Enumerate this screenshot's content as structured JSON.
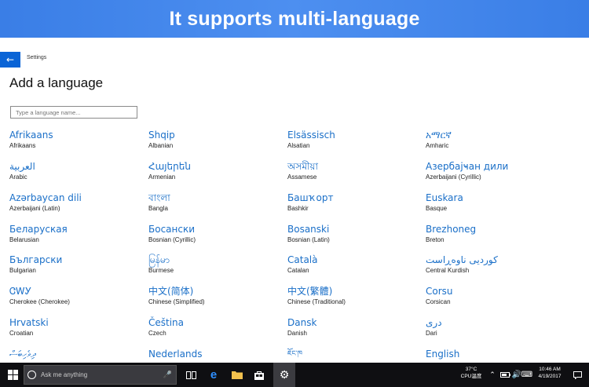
{
  "banner": {
    "title": "It supports multi-language"
  },
  "header": {
    "breadcrumb": "Settings",
    "title": "Add a language"
  },
  "search": {
    "placeholder": "Type a language name..."
  },
  "languages": [
    {
      "native": "Afrikaans",
      "english": "Afrikaans"
    },
    {
      "native": "Shqip",
      "english": "Albanian"
    },
    {
      "native": "Elsässisch",
      "english": "Alsatian"
    },
    {
      "native": "አማርኛ",
      "english": "Amharic"
    },
    {
      "native": "العربية",
      "english": "Arabic"
    },
    {
      "native": "Հայերեն",
      "english": "Armenian"
    },
    {
      "native": "অসমীয়া",
      "english": "Assamese"
    },
    {
      "native": "Азербајҹан дили",
      "english": "Azerbaijani (Cyrillic)"
    },
    {
      "native": "Azərbaycan dili",
      "english": "Azerbaijani (Latin)"
    },
    {
      "native": "বাংলা",
      "english": "Bangla"
    },
    {
      "native": "Башҡорт",
      "english": "Bashkir"
    },
    {
      "native": "Euskara",
      "english": "Basque"
    },
    {
      "native": "Беларуская",
      "english": "Belarusian"
    },
    {
      "native": "Босански",
      "english": "Bosnian (Cyrillic)"
    },
    {
      "native": "Bosanski",
      "english": "Bosnian (Latin)"
    },
    {
      "native": "Brezhoneg",
      "english": "Breton"
    },
    {
      "native": "Български",
      "english": "Bulgarian"
    },
    {
      "native": "မြန်မာ",
      "english": "Burmese"
    },
    {
      "native": "Català",
      "english": "Catalan"
    },
    {
      "native": "کوردیی ناوەڕاست",
      "english": "Central Kurdish"
    },
    {
      "native": "ᏣᎳᎩ",
      "english": "Cherokee (Cherokee)"
    },
    {
      "native": "中文(简体)",
      "english": "Chinese (Simplified)"
    },
    {
      "native": "中文(繁體)",
      "english": "Chinese (Traditional)"
    },
    {
      "native": "Corsu",
      "english": "Corsican"
    },
    {
      "native": "Hrvatski",
      "english": "Croatian"
    },
    {
      "native": "Čeština",
      "english": "Czech"
    },
    {
      "native": "Dansk",
      "english": "Danish"
    },
    {
      "native": "درى",
      "english": "Dari"
    },
    {
      "native": "ދިވެހިބަސް",
      "english": ""
    },
    {
      "native": "Nederlands",
      "english": ""
    },
    {
      "native": "ཇོང་ཁ",
      "english": ""
    },
    {
      "native": "English",
      "english": ""
    }
  ],
  "taskbar": {
    "search_placeholder": "Ask me anything",
    "temp": "37°C",
    "temp_label": "CPU温度",
    "time": "10:46 AM",
    "date": "4/19/2017"
  }
}
